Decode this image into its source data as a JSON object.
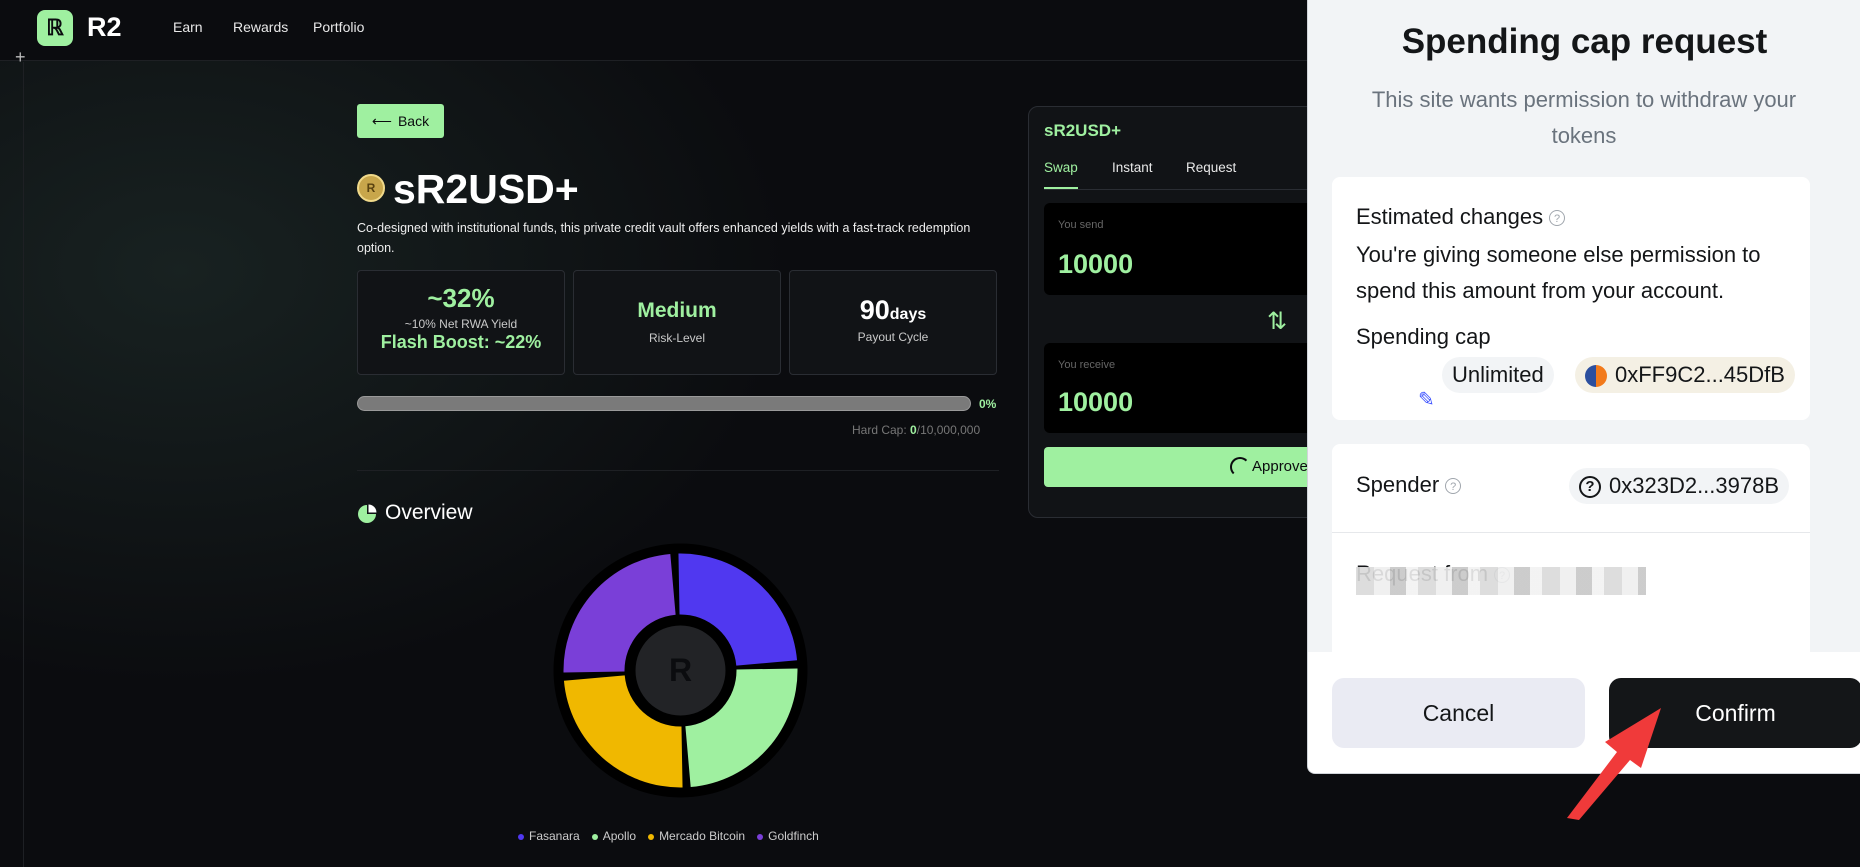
{
  "nav": {
    "logo": "R2",
    "items": [
      "Earn",
      "Rewards",
      "Portfolio"
    ]
  },
  "vault": {
    "back_label": "Back",
    "title": "sR2USD+",
    "description": "Co-designed with institutional funds, this private credit vault offers enhanced yields with a fast-track redemption option.",
    "stats": {
      "yield": "~32%",
      "yield_sub": "~10% Net RWA Yield",
      "flash_boost": "Flash Boost: ~22%",
      "risk": "Medium",
      "risk_label": "Risk-Level",
      "payout_value": "90",
      "payout_unit": "days",
      "payout_label": "Payout Cycle"
    },
    "progress": {
      "percent_label": "0%",
      "fill_fraction": 0.0
    },
    "hardcap": {
      "label": "Hard Cap:",
      "value": "0",
      "total": "/10,000,000"
    },
    "overview_title": "Overview",
    "legend": [
      "Fasanara",
      "Apollo",
      "Mercado Bitcoin",
      "Goldfinch"
    ]
  },
  "chart_data": {
    "type": "pie",
    "categories": [
      "Fasanara",
      "Apollo",
      "Mercado Bitcoin",
      "Goldfinch"
    ],
    "values": [
      25,
      25,
      25,
      25
    ],
    "colors": [
      "#5038f0",
      "#9ff0a0",
      "#f0b800",
      "#7a3fd8"
    ]
  },
  "swap": {
    "title": "sR2USD+",
    "tabs": [
      "Swap",
      "Instant",
      "Request"
    ],
    "send_label": "You send",
    "send_value": "10000",
    "receive_label": "You receive",
    "receive_value": "10000",
    "approve_label": "Approve"
  },
  "popup": {
    "title": "Spending cap request",
    "subtitle": "This site wants permission to withdraw your tokens",
    "estimated_changes_label": "Estimated changes",
    "estimated_changes_text": "You're giving someone else permission to spend this amount from your account.",
    "spending_cap_label": "Spending cap",
    "spending_cap_value": "Unlimited",
    "token_address": "0xFF9C2...45DfB",
    "spender_label": "Spender",
    "spender_address": "0x323D2...3978B",
    "request_from_label": "Request from",
    "cancel_label": "Cancel",
    "confirm_label": "Confirm"
  },
  "colors": {
    "accent_green": "#9ff0a0",
    "background": "#0b0c0f",
    "annotation_red": "#f03a3a"
  }
}
